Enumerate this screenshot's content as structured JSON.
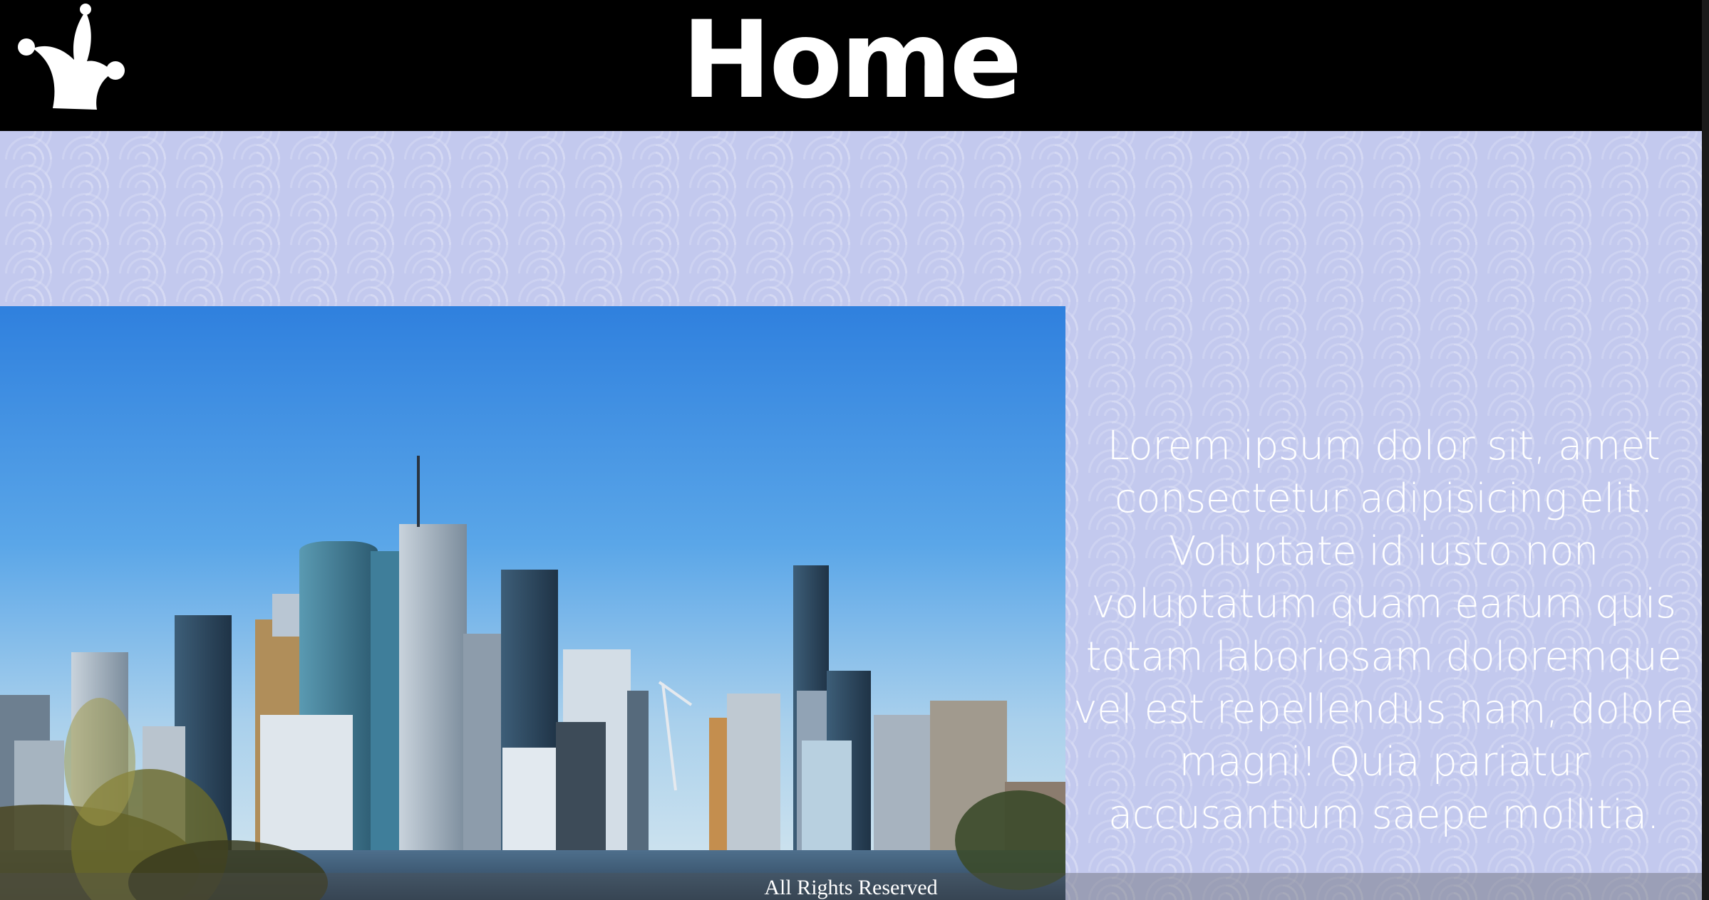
{
  "header": {
    "logo_icon": "jester-hat-icon",
    "title": "Home"
  },
  "main": {
    "image_alt": "Brisbane city skyline across the river",
    "paragraph": "Lorem ipsum dolor sit, amet consectetur adipisicing elit. Voluptate id iusto non voluptatum quam earum quis totam laboriosam doloremque vel est repellendus nam, dolore magni! Quia pariatur accusantium saepe mollitia."
  },
  "footer": {
    "text": "All Rights Reserved"
  },
  "colors": {
    "header_bg": "#000000",
    "main_bg": "#c3c9ee",
    "text": "#ffffff"
  }
}
